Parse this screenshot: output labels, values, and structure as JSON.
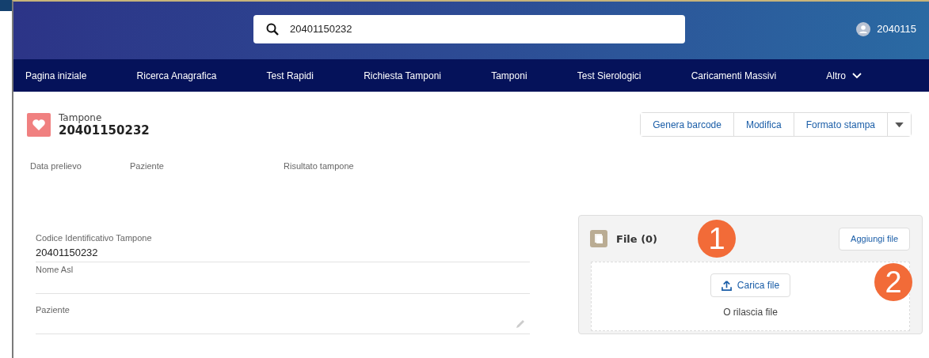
{
  "search": {
    "value": "20401150232"
  },
  "user": {
    "name": "2040115"
  },
  "nav": [
    {
      "label": "Pagina iniziale",
      "dropdown": false
    },
    {
      "label": "Ricerca Anagrafica",
      "dropdown": false
    },
    {
      "label": "Test Rapidi",
      "dropdown": false
    },
    {
      "label": "Richiesta Tamponi",
      "dropdown": false
    },
    {
      "label": "Tamponi",
      "dropdown": false
    },
    {
      "label": "Test Sierologici",
      "dropdown": false
    },
    {
      "label": "Caricamenti Massivi",
      "dropdown": false
    },
    {
      "label": "Altro",
      "dropdown": true
    }
  ],
  "record": {
    "type": "Tampone",
    "title": "20401150232"
  },
  "actions": [
    "Genera barcode",
    "Modifica",
    "Formato stampa"
  ],
  "highlights": [
    "Data prelievo",
    "Paziente",
    "Risultato tampone"
  ],
  "fields": [
    {
      "label": "Codice Identificativo Tampone",
      "value": "20401150232",
      "editable": false
    },
    {
      "label": "Nome Asl",
      "editable": false
    },
    {
      "label": "Paziente",
      "editable": true
    }
  ],
  "files": {
    "title": "File (0)",
    "add_button": "Aggiungi file",
    "upload_button": "Carica file",
    "drop_text": "O rilascia file"
  },
  "callouts": [
    {
      "label": "1"
    },
    {
      "label": "2"
    }
  ]
}
